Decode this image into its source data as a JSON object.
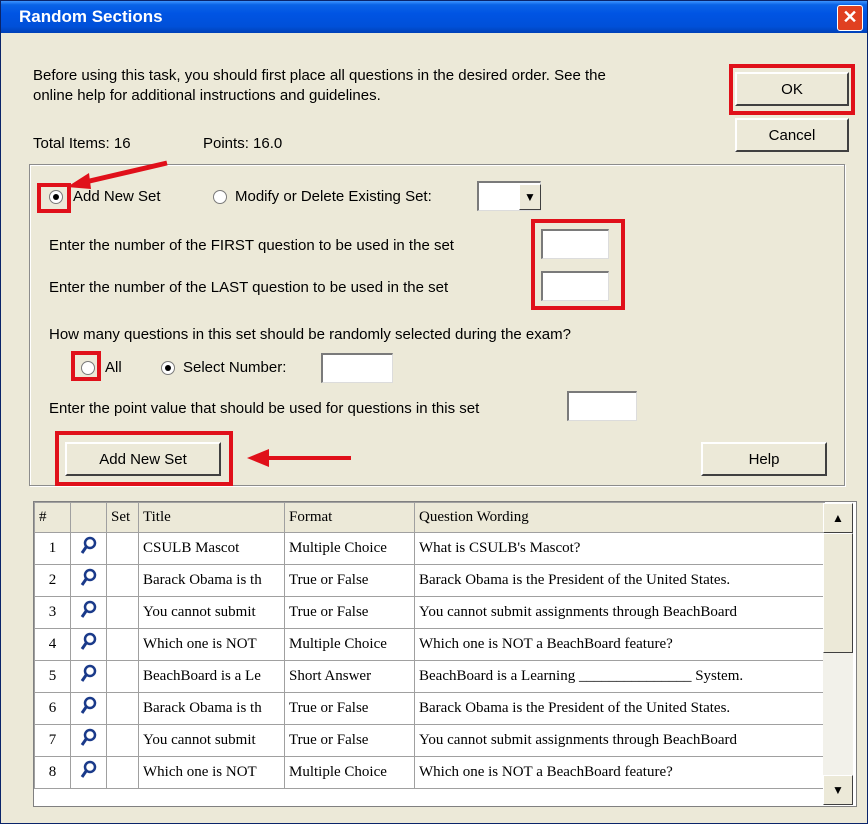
{
  "window": {
    "title": "Random Sections",
    "close_icon": "close-icon"
  },
  "intro_text_line1": "Before using this task, you should first place all questions in the desired order.  See the",
  "intro_text_line2": "online help for additional instructions and guidelines.",
  "total_items_label": "Total Items: 16",
  "points_label": "Points: 16.0",
  "ok_label": "OK",
  "cancel_label": "Cancel",
  "options": {
    "add_new_set_label": "Add New Set",
    "modify_label": "Modify or Delete Existing Set:",
    "add_new_set_selected": true
  },
  "first_question_label": "Enter the number of the FIRST question to be used in the set",
  "last_question_label": "Enter the number of the LAST question to be used in the set",
  "how_many_label": "How many questions in this set should be randomly selected during the exam?",
  "all_label": "All",
  "select_number_label": "Select Number:",
  "point_value_label": "Enter the point value that should be used for questions in this set",
  "add_new_set_button": "Add New Set",
  "help_button": "Help",
  "table": {
    "columns": [
      "#",
      "",
      "Set",
      "Title",
      "Format",
      "Question Wording"
    ],
    "rows": [
      {
        "num": "1",
        "set": "",
        "title": "CSULB Mascot",
        "format": "Multiple Choice",
        "wording": "What is CSULB's Mascot?"
      },
      {
        "num": "2",
        "set": "",
        "title": "Barack Obama is th",
        "format": "True or False",
        "wording": "Barack Obama is the President of the United States."
      },
      {
        "num": "3",
        "set": "",
        "title": "You cannot submit",
        "format": "True or False",
        "wording": "You cannot submit assignments through BeachBoard"
      },
      {
        "num": "4",
        "set": "",
        "title": "Which one is NOT",
        "format": "Multiple Choice",
        "wording": "Which one is NOT a BeachBoard feature?"
      },
      {
        "num": "5",
        "set": "",
        "title": "BeachBoard is a Le",
        "format": "Short Answer",
        "wording": "BeachBoard is a Learning _______________ System."
      },
      {
        "num": "6",
        "set": "",
        "title": "Barack Obama is th",
        "format": "True or False",
        "wording": "Barack Obama is the President of the United States."
      },
      {
        "num": "7",
        "set": "",
        "title": "You cannot submit",
        "format": "True or False",
        "wording": "You cannot submit assignments through BeachBoard"
      },
      {
        "num": "8",
        "set": "",
        "title": "Which one is NOT",
        "format": "Multiple Choice",
        "wording": "Which one is NOT a BeachBoard feature?"
      }
    ]
  },
  "colors": {
    "highlight": "#e0101a",
    "title_bar": "#0054e3",
    "dialog_bg": "#ece9d8"
  }
}
